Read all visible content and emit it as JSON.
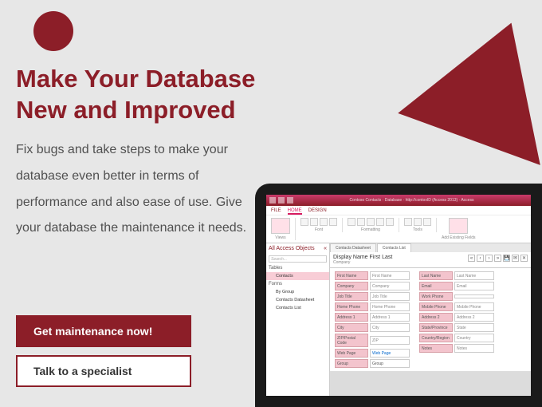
{
  "heading": "Make Your Database\nNew and Improved",
  "body": "Fix bugs and take steps to make your database even better in terms of performance and also ease of use. Give your database the maintenance it needs.",
  "cta_primary": "Get maintenance now!",
  "cta_secondary": "Talk to a specialist",
  "app": {
    "titlebar": "Contoso Contacts · Database · http://contoxID (Access 2013) · Access",
    "ribbon_tabs": {
      "file": "FILE",
      "home": "HOME",
      "design": "DESIGN"
    },
    "ribbon_groups": {
      "views": "Views",
      "font": "Font",
      "formatting": "Formatting",
      "tools": "Tools",
      "add": "Add Existing Fields"
    },
    "nav_header": "All Access Objects",
    "nav_search": "Search...",
    "nav": {
      "tables": "Tables",
      "contacts": "Contacts",
      "forms": "Forms",
      "by_group": "By Group",
      "contacts_ds": "Contacts Datasheet",
      "contacts_list": "Contacts List"
    },
    "obj_tabs": {
      "ds": "Contacts Datasheet",
      "list": "Contacts List"
    },
    "form_label": "Company",
    "form_title": "Display Name First Last",
    "fields": {
      "first_name": {
        "l": "First Name",
        "v": "First Name"
      },
      "company": {
        "l": "Company",
        "v": "Company"
      },
      "job_title": {
        "l": "Job Title",
        "v": "Job Title"
      },
      "home_phone": {
        "l": "Home Phone",
        "v": "Home Phone"
      },
      "address1": {
        "l": "Address 1",
        "v": "Address 1"
      },
      "city": {
        "l": "City",
        "v": "City"
      },
      "zip": {
        "l": "ZIP/Postal Code",
        "v": "ZIP"
      },
      "web_page": {
        "l": "Web Page",
        "v": "Web Page"
      },
      "group": {
        "l": "Group",
        "v": "Group"
      },
      "last_name": {
        "l": "Last Name",
        "v": "Last Name"
      },
      "email": {
        "l": "Email",
        "v": "Email"
      },
      "work_phone": {
        "l": "Work Phone",
        "v": ""
      },
      "mobile_phone": {
        "l": "Mobile Phone",
        "v": "Mobile Phone"
      },
      "address2": {
        "l": "Address 2",
        "v": "Address 2"
      },
      "state": {
        "l": "State/Province",
        "v": "State"
      },
      "country": {
        "l": "Country/Region",
        "v": "Country"
      },
      "notes": {
        "l": "Notes",
        "v": "Notes"
      }
    }
  }
}
